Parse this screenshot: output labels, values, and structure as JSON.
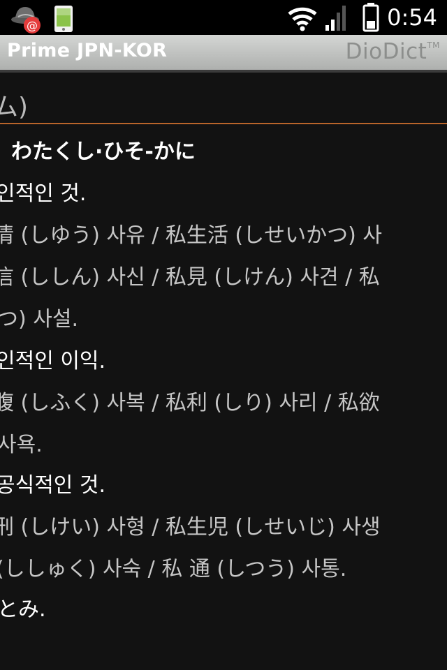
{
  "status_bar": {
    "notification_icons": [
      "email-notification-icon",
      "phone-notification-icon"
    ],
    "system_icons": [
      "wifi-icon",
      "signal-icon",
      "battery-icon"
    ],
    "time": "0:54"
  },
  "title_bar": {
    "app_title": "Prime JPN-KOR",
    "brand": "DioDict",
    "brand_tm": "TM"
  },
  "entry": {
    "headword_fragment": "ム)",
    "reading_line": "わたくし·ひそ-かに",
    "lines": [
      {
        "type": "sense",
        "text": "인적인 것."
      },
      {
        "type": "example",
        "text": "情 (しゆう) 사유 / 私生活 (しせいかつ) 사"
      },
      {
        "type": "example",
        "text": "信 (ししん) 사신 / 私見 (しけん) 사견 / 私"
      },
      {
        "type": "example",
        "text": "つ) 사설."
      },
      {
        "type": "sense",
        "text": "인적인 이익."
      },
      {
        "type": "example",
        "text": "腹 (しふく) 사복 / 私利 (しり) 사리 / 私欲"
      },
      {
        "type": "example",
        "text": " 사욕."
      },
      {
        "type": "sense",
        "text": "공식적인 것."
      },
      {
        "type": "example",
        "text": "刑 (しけい) 사형 / 私生児 (しせいじ) 사생"
      },
      {
        "type": "example",
        "text": "(ししゅく) 사숙 / 私 通 (しつう) 사통."
      },
      {
        "type": "sense",
        "text": " とみ."
      }
    ]
  }
}
